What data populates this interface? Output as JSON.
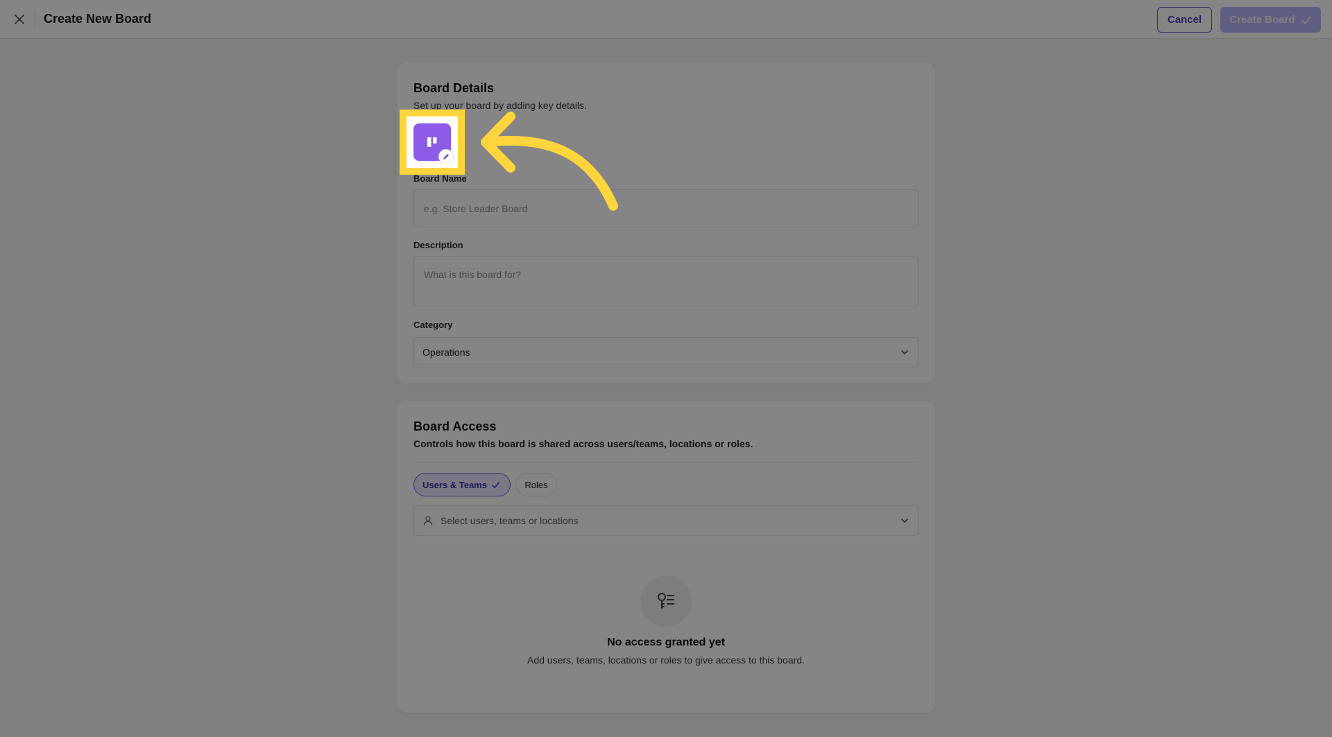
{
  "header": {
    "title": "Create New Board",
    "cancel_label": "Cancel",
    "create_label": "Create Board"
  },
  "details": {
    "title": "Board Details",
    "subtitle": "Set up your board by adding key details.",
    "icon_name": "board-columns-icon",
    "icon_color": "#8c5ce8",
    "board_name": {
      "label": "Board Name",
      "placeholder": "e.g. Store Leader Board",
      "value": ""
    },
    "description": {
      "label": "Description",
      "placeholder": "What is this board for?",
      "value": ""
    },
    "category": {
      "label": "Category",
      "value": "Operations"
    }
  },
  "access": {
    "title": "Board Access",
    "subtitle": "Controls how this board is shared across users/teams, locations or roles.",
    "tabs": [
      {
        "label": "Users & Teams",
        "selected": true
      },
      {
        "label": "Roles",
        "selected": false
      }
    ],
    "select_placeholder": "Select users, teams or locations",
    "empty_title": "No access granted yet",
    "empty_subtitle": "Add users, teams, locations or roles to give access to this board."
  },
  "colors": {
    "accent": "#5b55c9",
    "highlight": "#ffd53d"
  }
}
